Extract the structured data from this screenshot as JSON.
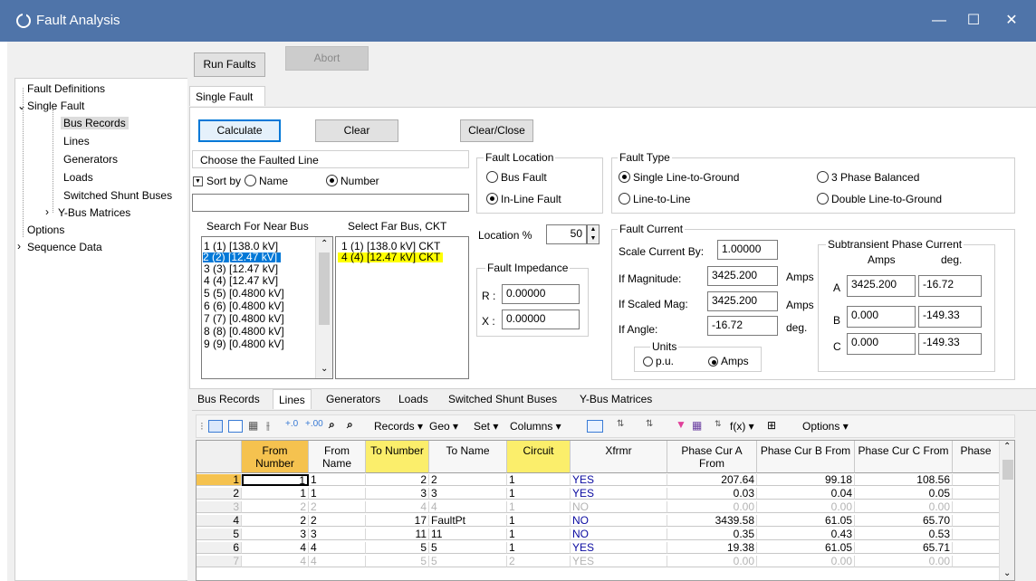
{
  "window": {
    "title": "Fault Analysis",
    "minimize": "—",
    "maximize": "☐",
    "close": "✕"
  },
  "tree": {
    "items": [
      {
        "label": "Fault Definitions"
      },
      {
        "label": "Single Fault"
      },
      {
        "label": "Bus Records"
      },
      {
        "label": "Lines"
      },
      {
        "label": "Generators"
      },
      {
        "label": "Loads"
      },
      {
        "label": "Switched Shunt Buses"
      },
      {
        "label": "Y-Bus Matrices"
      },
      {
        "label": "Options"
      },
      {
        "label": "Sequence Data"
      }
    ]
  },
  "toolbar": {
    "run_faults": "Run Faults",
    "abort": "Abort"
  },
  "main_tab": "Single Fault",
  "actions": {
    "calculate": "Calculate",
    "clear": "Clear",
    "clear_close": "Clear/Close"
  },
  "choose": {
    "title": "Choose the Faulted Line",
    "sort_by": "Sort by",
    "name_option": "Name",
    "number_option": "Number",
    "search_value": "",
    "near_header": "Search For Near Bus",
    "far_header": "Select Far Bus, CKT",
    "near_buses": [
      "1 (1)  [138.0 kV]",
      "2 (2)  [12.47 kV]",
      "3 (3)  [12.47 kV]",
      "4 (4)  [12.47 kV]",
      "5 (5)  [0.4800 kV]",
      "6 (6)  [0.4800 kV]",
      "7 (7)  [0.4800 kV]",
      "8 (8)  [0.4800 kV]",
      "9 (9)  [0.4800 kV]"
    ],
    "far_buses": [
      "1 (1) [138.0 kV] CKT",
      "4 (4) [12.47 kV] CKT"
    ]
  },
  "fault_location": {
    "title": "Fault Location",
    "bus_fault": "Bus Fault",
    "inline_fault": "In-Line Fault",
    "location_label": "Location %",
    "location_value": "50"
  },
  "fault_impedance": {
    "title": "Fault Impedance",
    "r_label": "R :",
    "r_value": "0.00000",
    "x_label": "X :",
    "x_value": "0.00000"
  },
  "fault_type": {
    "title": "Fault Type",
    "slg": "Single Line-to-Ground",
    "three_phase": "3 Phase Balanced",
    "ll": "Line-to-Line",
    "dlg": "Double Line-to-Ground"
  },
  "fault_current": {
    "title": "Fault Current",
    "scale_label": "Scale Current By:",
    "scale_value": "1.00000",
    "mag_label": "If Magnitude:",
    "mag_value": "3425.200",
    "mag_unit": "Amps",
    "scaled_label": "If Scaled Mag:",
    "scaled_value": "3425.200",
    "scaled_unit": "Amps",
    "angle_label": "If Angle:",
    "angle_value": "-16.72",
    "angle_unit": "deg.",
    "units_title": "Units",
    "units_pu": "p.u.",
    "units_amps": "Amps",
    "sub_title": "Subtransient Phase Current",
    "sub_amps": "Amps",
    "sub_deg": "deg.",
    "phases": [
      {
        "label": "A",
        "amps": "3425.200",
        "deg": "-16.72"
      },
      {
        "label": "B",
        "amps": "0.000",
        "deg": "-149.33"
      },
      {
        "label": "C",
        "amps": "0.000",
        "deg": "-149.33"
      }
    ]
  },
  "bottom_tabs": [
    "Bus Records",
    "Lines",
    "Generators",
    "Loads",
    "Switched Shunt Buses",
    "Y-Bus Matrices"
  ],
  "grid_toolbar": {
    "records": "Records ▾",
    "geo": "Geo ▾",
    "set": "Set ▾",
    "columns": "Columns ▾",
    "fx": "f(x) ▾",
    "options": "Options ▾"
  },
  "grid": {
    "headers": [
      "From Number",
      "From Name",
      "To Number",
      "To Name",
      "Circuit",
      "Xfrmr",
      "Phase Cur A From",
      "Phase Cur B From",
      "Phase Cur C From",
      "Phase"
    ],
    "rows": [
      [
        "1",
        "1",
        "1",
        "2",
        "2",
        "1",
        "YES",
        "207.64",
        "99.18",
        "108.56"
      ],
      [
        "2",
        "1",
        "1",
        "3",
        "3",
        "1",
        "YES",
        "0.03",
        "0.04",
        "0.05"
      ],
      [
        "3",
        "2",
        "2",
        "4",
        "4",
        "1",
        "NO",
        "0.00",
        "0.00",
        "0.00"
      ],
      [
        "4",
        "2",
        "2",
        "17",
        "FaultPt",
        "1",
        "NO",
        "3439.58",
        "61.05",
        "65.70"
      ],
      [
        "5",
        "3",
        "3",
        "11",
        "11",
        "1",
        "NO",
        "0.35",
        "0.43",
        "0.53"
      ],
      [
        "6",
        "4",
        "4",
        "5",
        "5",
        "1",
        "YES",
        "19.38",
        "61.05",
        "65.71"
      ],
      [
        "7",
        "4",
        "4",
        "5",
        "5",
        "2",
        "YES",
        "0.00",
        "0.00",
        "0.00"
      ]
    ]
  }
}
